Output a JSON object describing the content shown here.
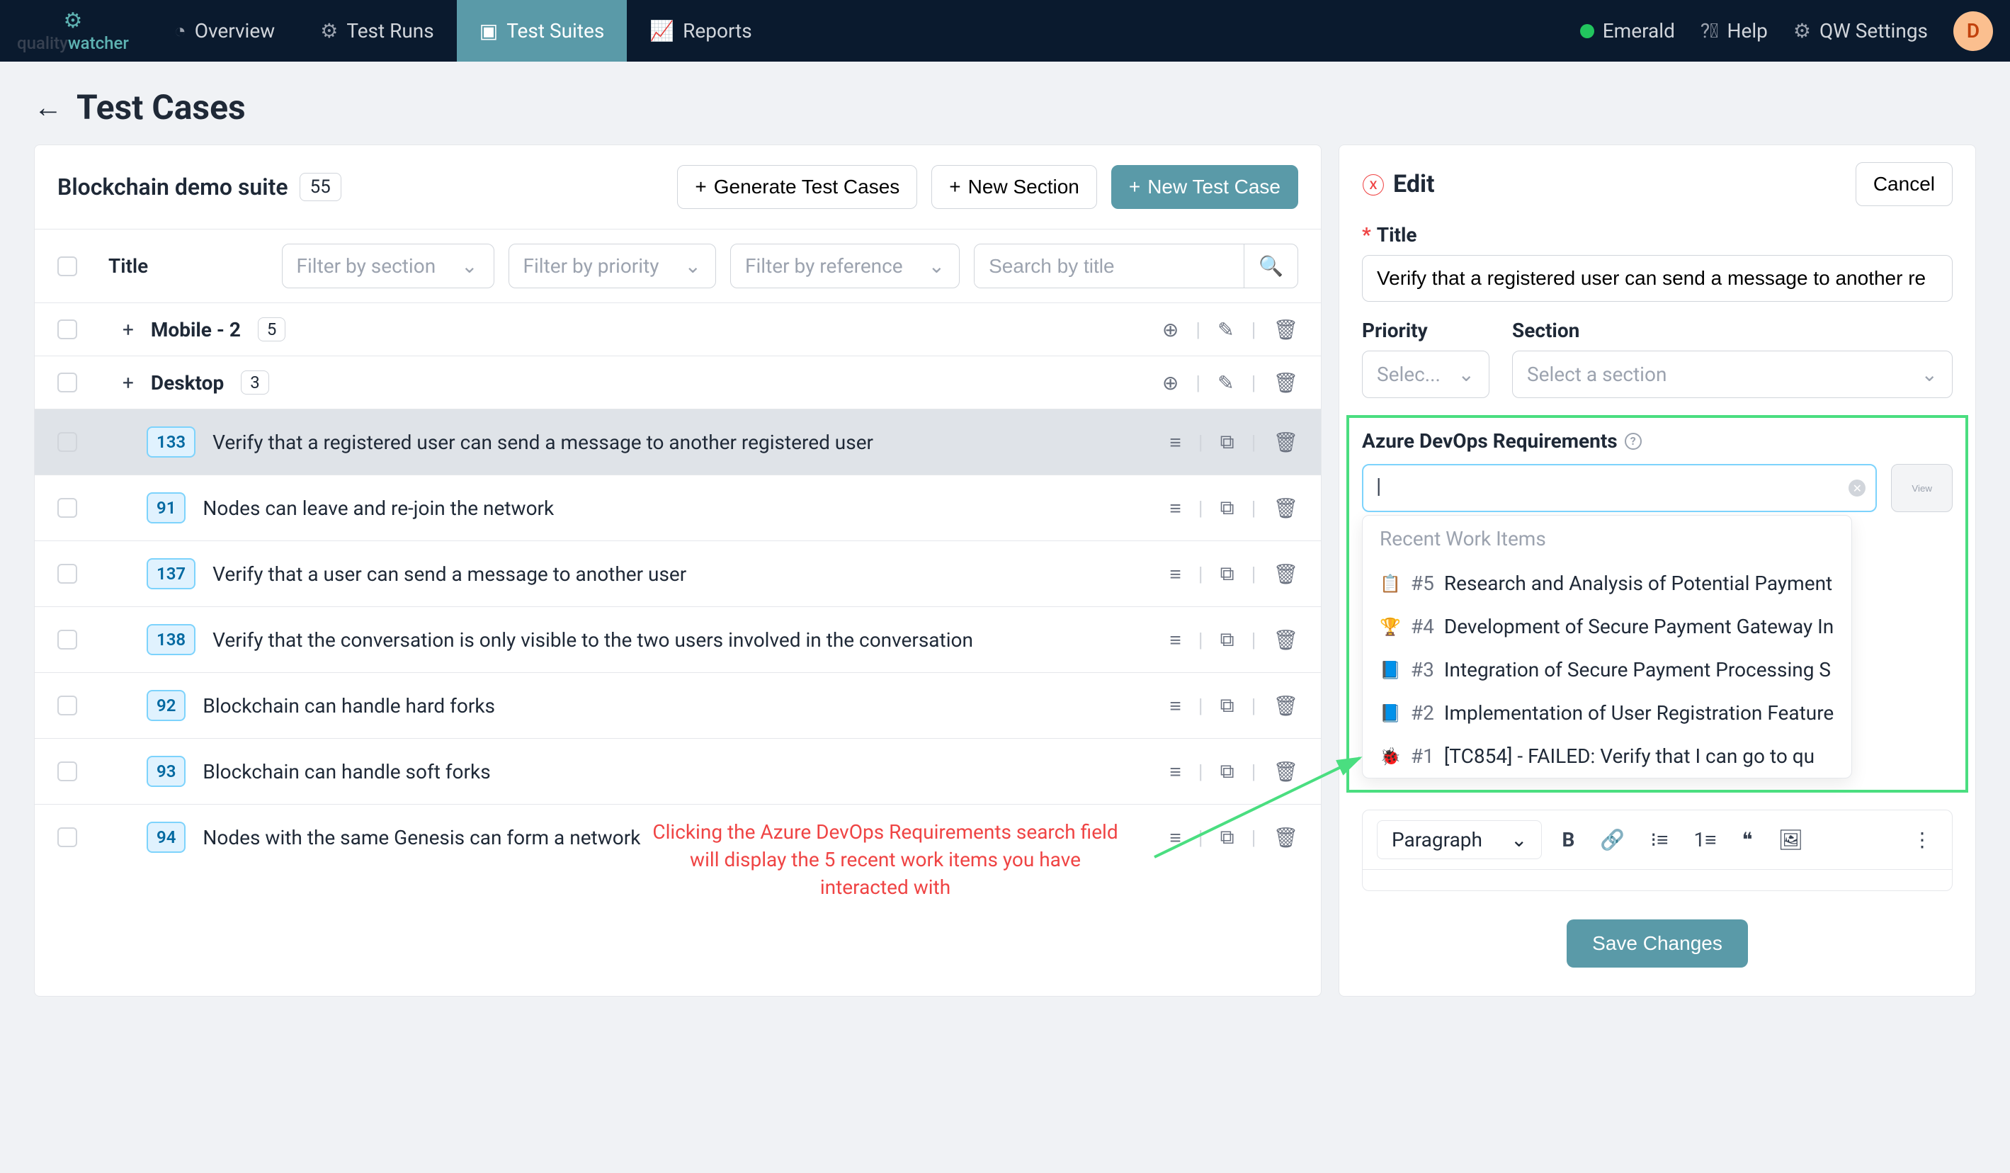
{
  "nav": {
    "logo": "qualitywatcher",
    "items": [
      {
        "label": "Overview"
      },
      {
        "label": "Test Runs"
      },
      {
        "label": "Test Suites"
      },
      {
        "label": "Reports"
      }
    ],
    "team": "Emerald",
    "help": "Help",
    "settings": "QW Settings",
    "avatar_initial": "D"
  },
  "page": {
    "title": "Test Cases"
  },
  "suite": {
    "name": "Blockchain demo suite",
    "count": "55",
    "generate": "Generate Test Cases",
    "new_section": "New Section",
    "new_case": "New Test Case"
  },
  "filters": {
    "title_col": "Title",
    "section_ph": "Filter by section",
    "priority_ph": "Filter by priority",
    "reference_ph": "Filter by reference",
    "search_ph": "Search by title"
  },
  "sections": [
    {
      "name": "Mobile - 2",
      "count": "5"
    },
    {
      "name": "Desktop",
      "count": "3"
    }
  ],
  "cases": [
    {
      "id": "133",
      "title": "Verify that a registered user can send a message to another registered user",
      "selected": true
    },
    {
      "id": "91",
      "title": "Nodes can leave and re-join the network"
    },
    {
      "id": "137",
      "title": "Verify that a user can send a message to another user"
    },
    {
      "id": "138",
      "title": "Verify that the conversation is only visible to the two users involved in the conversation"
    },
    {
      "id": "92",
      "title": "Blockchain can handle hard forks"
    },
    {
      "id": "93",
      "title": "Blockchain can handle soft forks"
    },
    {
      "id": "94",
      "title": "Nodes with the same Genesis can form a network"
    }
  ],
  "edit": {
    "heading": "Edit",
    "cancel": "Cancel",
    "title_label": "Title",
    "title_value": "Verify that a registered user can send a message to another re",
    "priority_label": "Priority",
    "priority_ph": "Selec...",
    "section_label": "Section",
    "section_ph": "Select a section",
    "azure_label": "Azure DevOps Requirements",
    "view": "View",
    "recent": "Recent Work Items",
    "work_items": [
      {
        "icon": "📋",
        "id": "#5",
        "title": "Research and Analysis of Potential Payment"
      },
      {
        "icon": "🏆",
        "id": "#4",
        "title": "Development of Secure Payment Gateway In"
      },
      {
        "icon": "📘",
        "id": "#3",
        "title": "Integration of Secure Payment Processing S"
      },
      {
        "icon": "📘",
        "id": "#2",
        "title": "Implementation of User Registration Feature"
      },
      {
        "icon": "🐞",
        "id": "#1",
        "title": "[TC854] - FAILED: Verify that I can go to qu"
      }
    ],
    "paragraph": "Paragraph",
    "save": "Save Changes"
  },
  "annotation": {
    "text": "Clicking the Azure DevOps Requirements search field\nwill display the 5 recent work items you have\ninteracted with"
  }
}
